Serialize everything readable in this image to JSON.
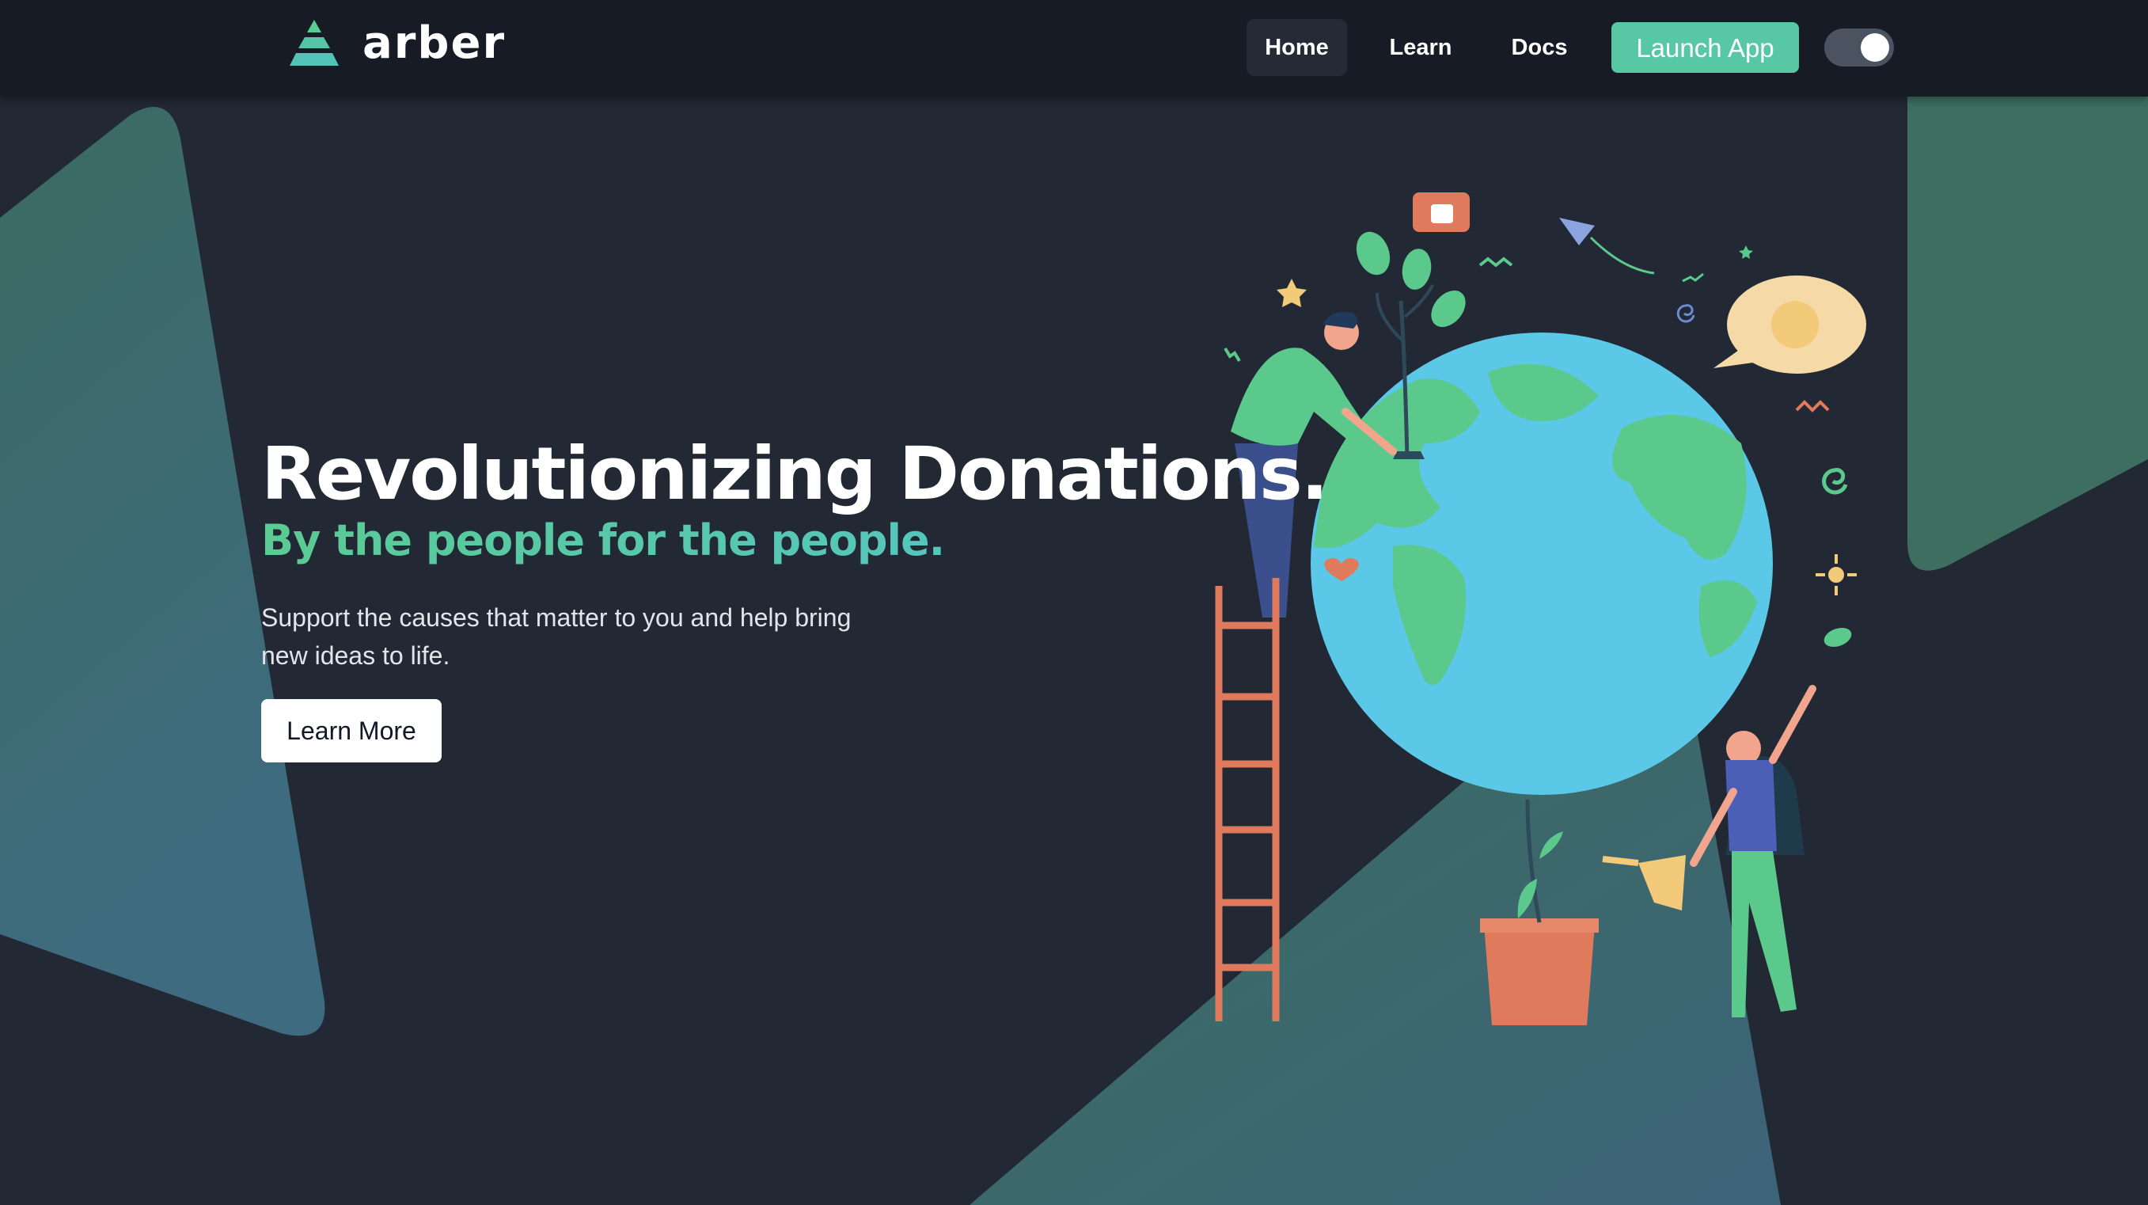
{
  "brand": {
    "name": "arber"
  },
  "nav": {
    "items": [
      {
        "label": "Home",
        "active": true
      },
      {
        "label": "Learn"
      },
      {
        "label": "Docs"
      }
    ],
    "launch_label": "Launch App",
    "theme_toggle": {
      "state": "on",
      "icon": "toggle-switch"
    }
  },
  "hero": {
    "title": "Revolutionizing Donations.",
    "subtitle": "By the people for the people.",
    "description": "Support the causes that matter to you and help bring new ideas to life.",
    "cta_label": "Learn More",
    "illustration": "people-planting-globe-illustration"
  },
  "colors": {
    "background": "#222834",
    "navbar": "#161b26",
    "accent": "#58c7a4",
    "shape_green": "#3c6b63"
  }
}
